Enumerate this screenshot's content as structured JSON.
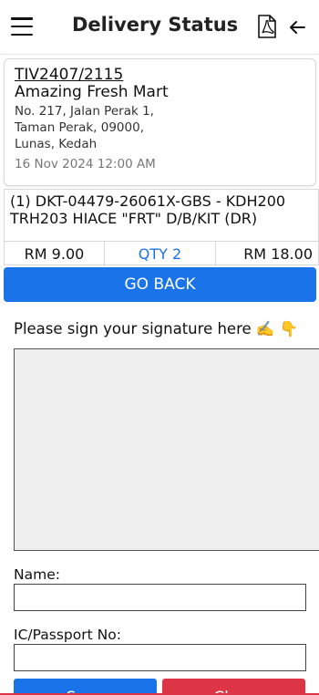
{
  "header": {
    "title": "Delivery Status",
    "icons": {
      "menu": "hamburger-menu-icon",
      "pdf": "pdf-file-icon",
      "back": "arrow-left-icon"
    }
  },
  "invoice": {
    "number": "TIV2407/2115",
    "store": "Amazing Fresh Mart",
    "address_lines": [
      "No. 217, Jalan Perak 1,",
      "Taman Perak, 09000,",
      "Lunas, Kedah"
    ],
    "date": "16 Nov 2024 12:00 AM"
  },
  "item": {
    "description": "(1) DKT-04479-26061X-GBS - KDH200 TRH203 HIACE \"FRT\" D/B/KIT (DR)",
    "price": "RM 9.00",
    "qty": "QTY 2",
    "total": "RM 18.00"
  },
  "go_back_label": "GO BACK",
  "signature": {
    "prompt": "Please sign your signature here ✍️ 👇"
  },
  "form": {
    "name_label": "Name:",
    "name_value": "",
    "ic_label": "IC/Passport No:",
    "ic_value": ""
  },
  "actions": {
    "save_label": "Save",
    "clear_label": "Clear"
  },
  "colors": {
    "primary": "#1a73e8",
    "danger": "#dc3545",
    "pad_bg": "#efefef"
  }
}
